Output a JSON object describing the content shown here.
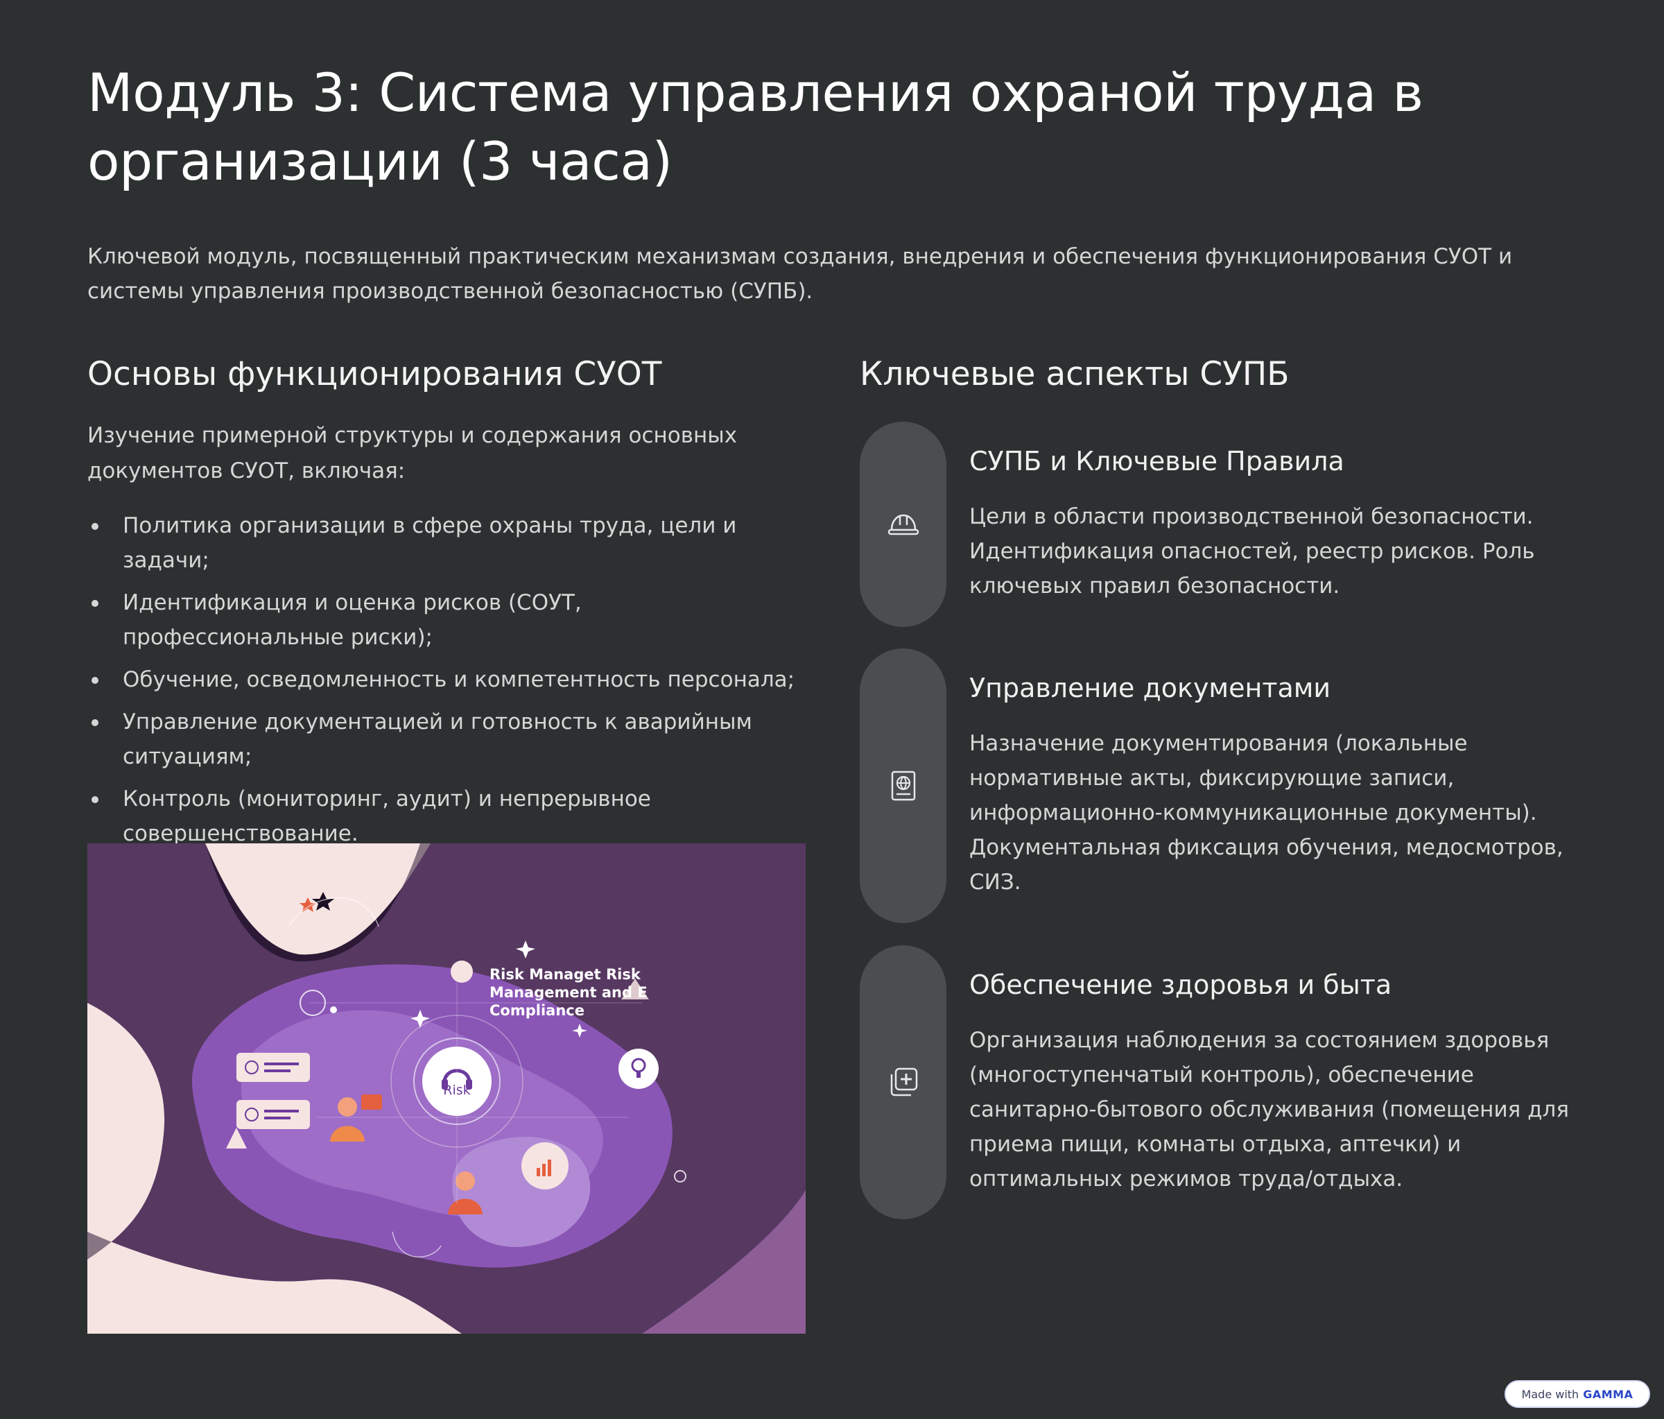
{
  "title": "Модуль 3: Система управления охраной труда в организации (3 часа)",
  "intro": "Ключевой модуль, посвященный практическим механизмам создания, внедрения и обеспечения функционирования СУОТ и системы управления производственной безопасностью (СУПБ).",
  "left": {
    "heading": "Основы функционирования СУОТ",
    "description": "Изучение примерной структуры и содержания основных документов СУОТ, включая:",
    "bullets": [
      "Политика организации в сфере охраны труда, цели и задачи;",
      "Идентификация и оценка рисков (СОУТ, профессиональные риски);",
      "Обучение, осведомленность и компетентность персонала;",
      "Управление документацией и готовность к аварийным ситуациям;",
      "Контроль (мониторинг, аудит) и непрерывное совершенствование."
    ],
    "illustration": {
      "caption_lines": [
        "Risk Managet Risk",
        "Management and E",
        "Compliance"
      ],
      "center_label": "Risk"
    }
  },
  "right": {
    "heading": "Ключевые аспекты СУПБ",
    "cards": [
      {
        "icon": "hard-hat-icon",
        "title": "СУПБ и Ключевые Правила",
        "text": "Цели в области производственной безопасности. Идентификация опасностей, реестр рисков. Роль ключевых правил безопасности."
      },
      {
        "icon": "document-globe-icon",
        "title": "Управление документами",
        "text": "Назначение документирования (локальные нормативные акты, фиксирующие записи, информационно-коммуникационные документы). Документальная фиксация обучения, медосмотров, СИЗ."
      },
      {
        "icon": "medical-plus-icon",
        "title": "Обеспечение здоровья и быта",
        "text": "Организация наблюдения за состоянием здоровья (многоступенчатый контроль), обеспечение санитарно-бытового обслуживания (помещения для приема пищи, комнаты отдыха, аптечки) и оптимальных режимов труда/отдыха."
      }
    ]
  },
  "badge": {
    "prefix": "Made with",
    "brand": "GAMMA"
  }
}
